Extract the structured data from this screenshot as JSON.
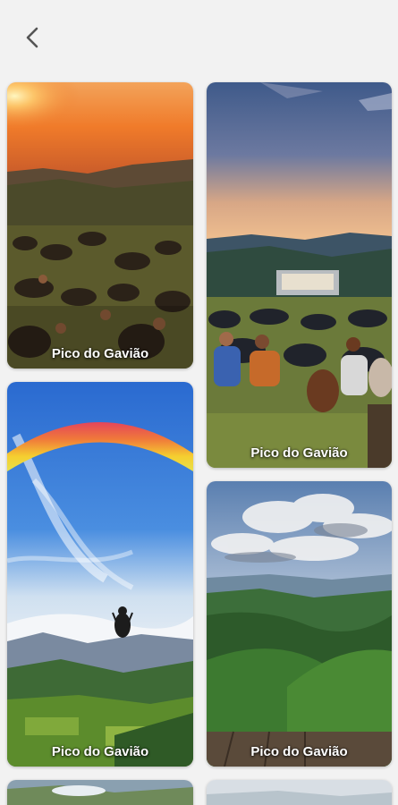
{
  "header": {
    "back_icon": "chevron-left-icon"
  },
  "gallery": {
    "items": [
      {
        "caption": "Pico do Gavião"
      },
      {
        "caption": "Pico do Gavião"
      },
      {
        "caption": "Pico do Gavião"
      },
      {
        "caption": "Pico do Gavião"
      }
    ]
  },
  "colors": {
    "background": "#f2f2f2",
    "caption_text": "#ffffff",
    "back_icon": "#555555"
  }
}
